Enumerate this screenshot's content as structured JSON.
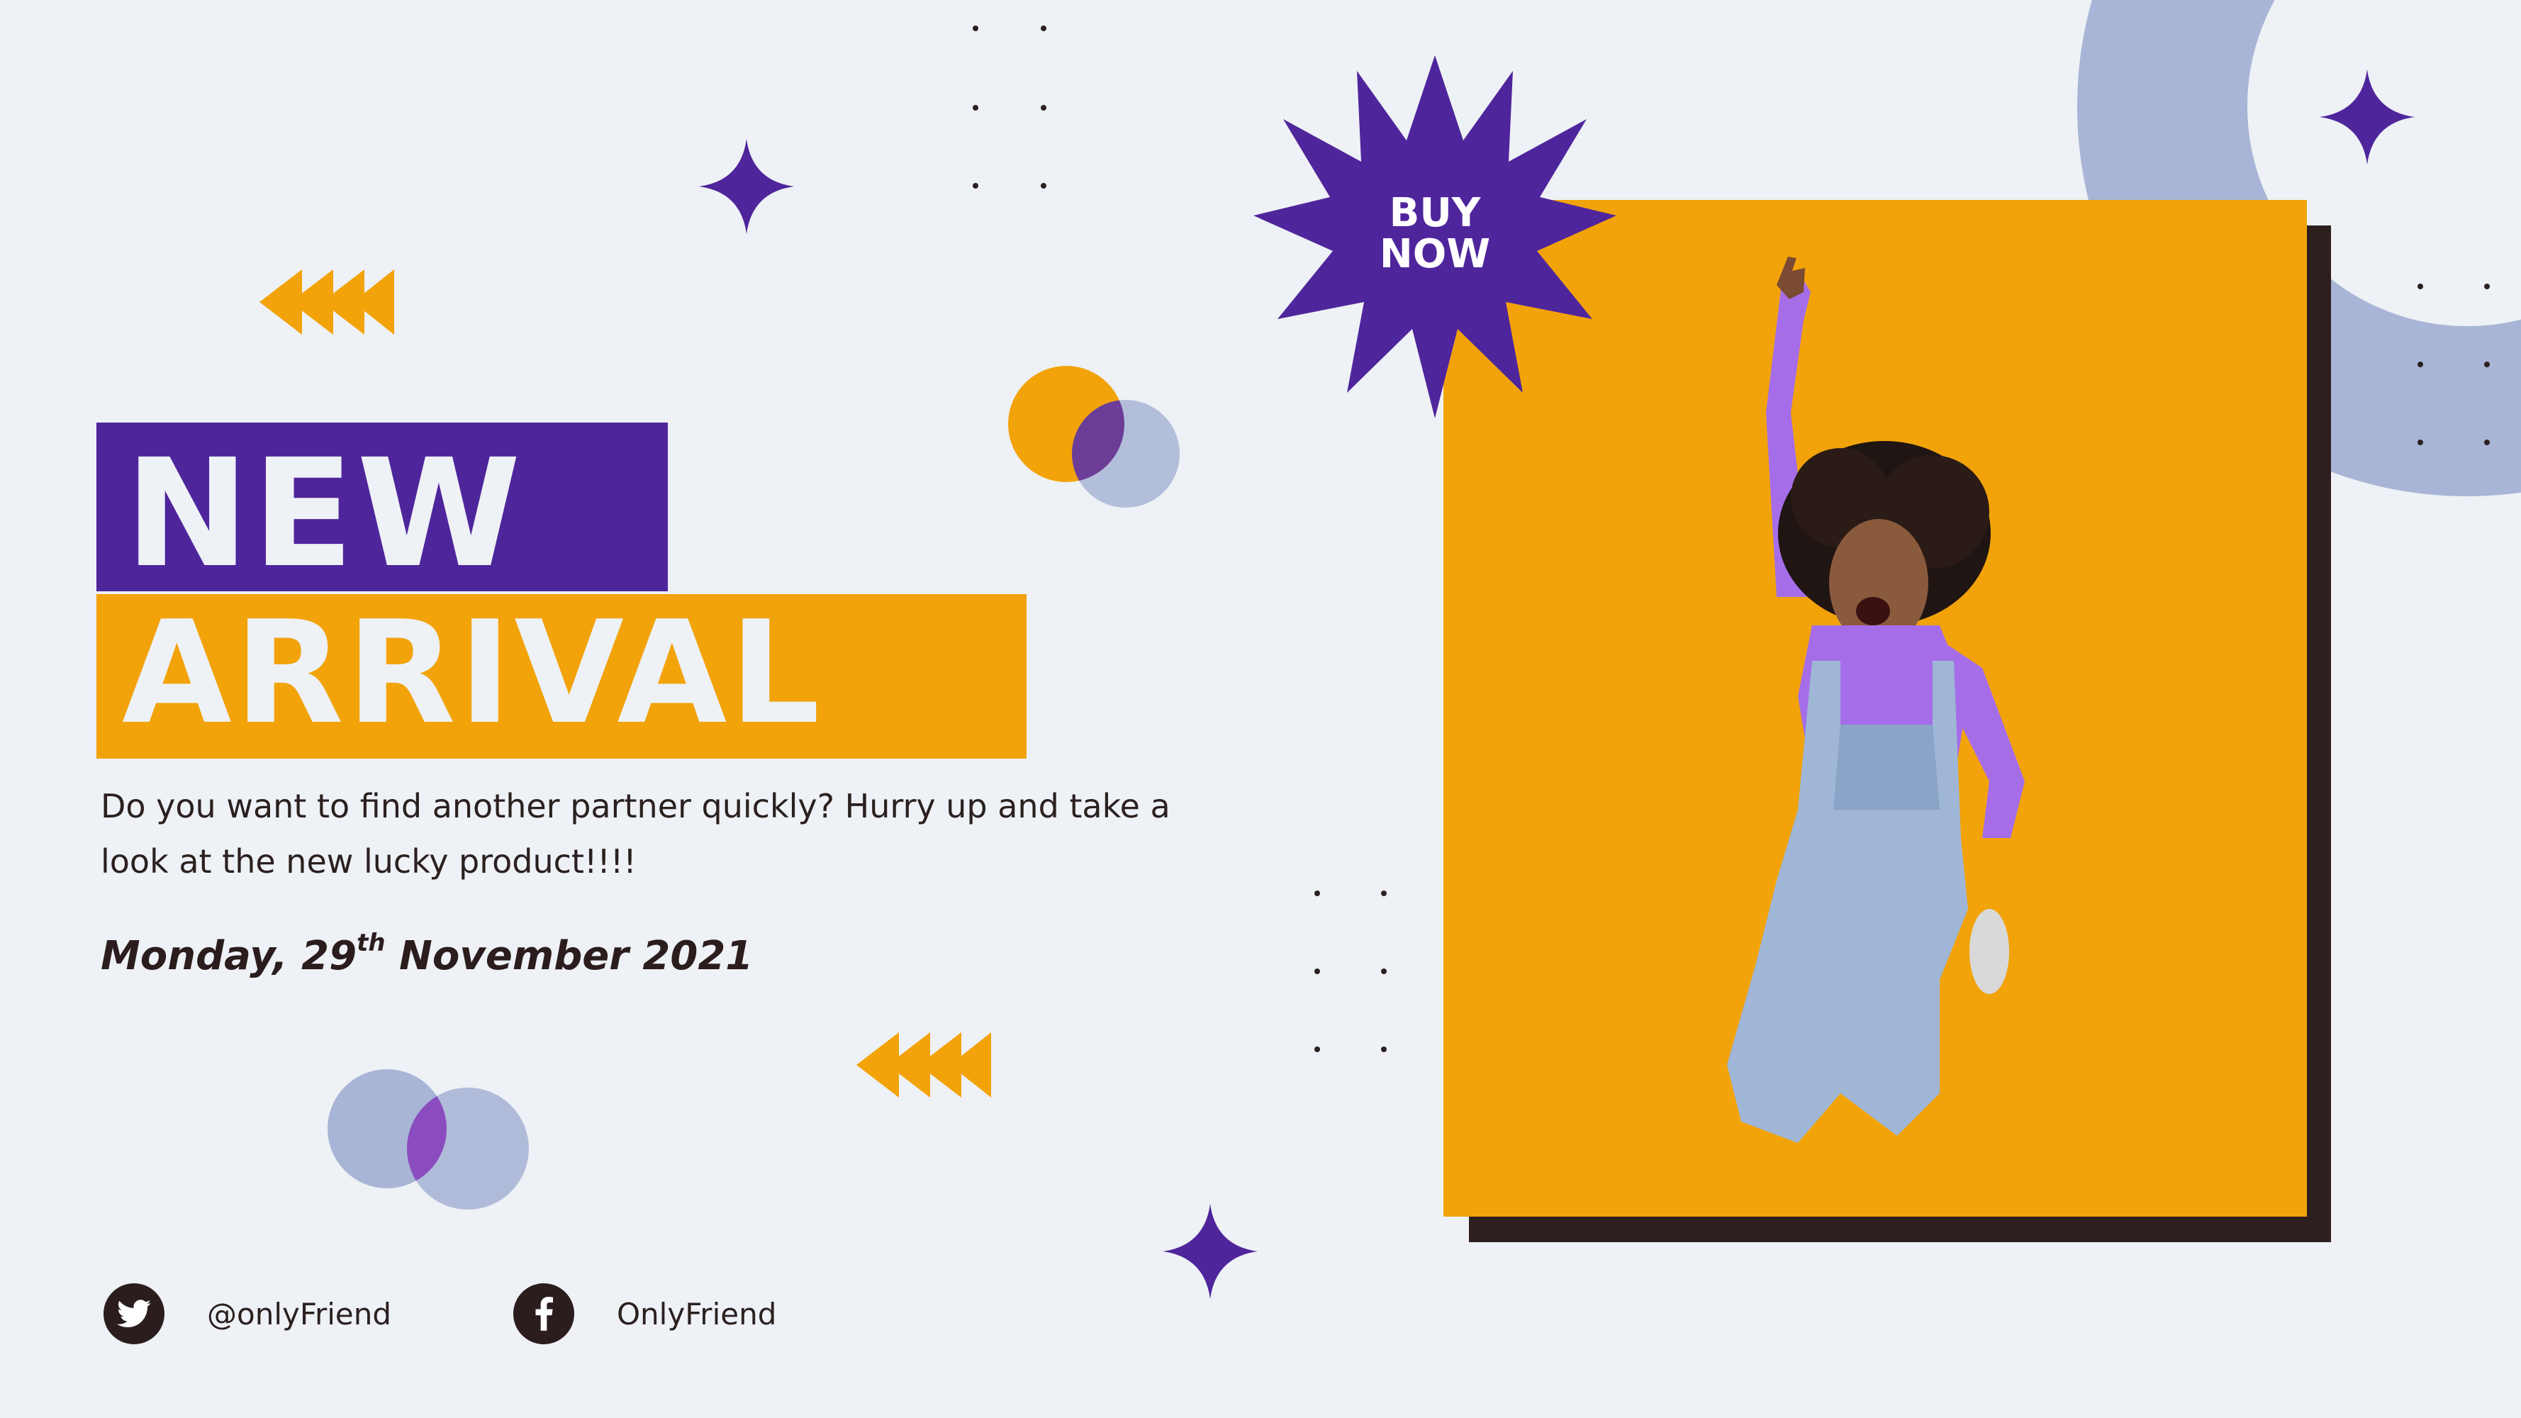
{
  "headline": {
    "line1": "NEW",
    "line2": "ARRIVAL"
  },
  "description": "Do you want to find another partner quickly? Hurry up and take a look at the new lucky product!!!!",
  "date": {
    "prefix": "Monday, 29",
    "superscript": "th",
    "suffix": " November 2021"
  },
  "badge": {
    "line1": "BUY",
    "line2": "NOW"
  },
  "social": {
    "twitter": {
      "icon": "twitter-icon",
      "handle": "@onlyFriend"
    },
    "facebook": {
      "icon": "facebook-icon",
      "handle": "OnlyFriend"
    }
  },
  "colors": {
    "background": "#eef1f5",
    "purple": "#4f259c",
    "orange": "#f2a30a",
    "lavender": "#a8b5d6",
    "dark": "#2b1d1d"
  },
  "photo": {
    "description_icon": "jumping-woman-image"
  }
}
